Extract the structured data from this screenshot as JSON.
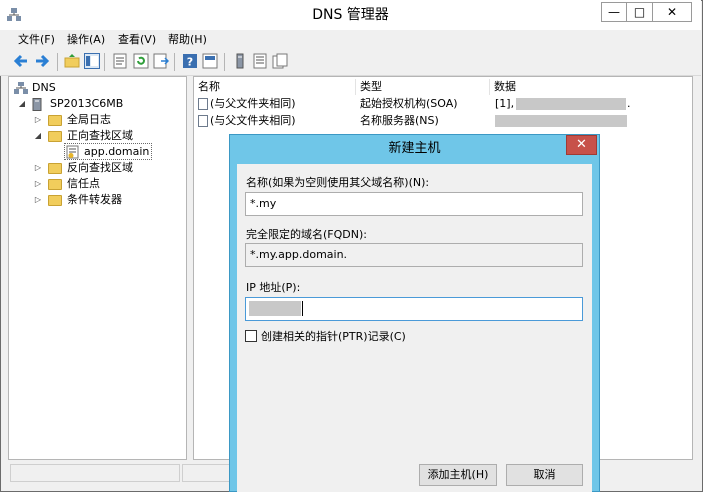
{
  "window": {
    "title": "DNS 管理器",
    "minimize": "—",
    "restore": "□",
    "close": "✕"
  },
  "menu": [
    "文件(F)",
    "操作(A)",
    "查看(V)",
    "帮助(H)"
  ],
  "toolbar_icons": [
    "back-arrow-icon",
    "forward-arrow-icon",
    "up-folder-icon",
    "show-tree-icon",
    "properties-icon",
    "refresh-icon",
    "export-list-icon",
    "help-icon",
    "console-icon",
    "server-icon",
    "zone-icon",
    "record-icon"
  ],
  "tree": {
    "root": "DNS",
    "server": "SP2013C6MB",
    "items": [
      {
        "label": "全局日志",
        "expanded": false
      },
      {
        "label": "正向查找区域",
        "expanded": true
      },
      {
        "label": "app.domain",
        "selected": true
      },
      {
        "label": "反向查找区域",
        "expanded": false
      },
      {
        "label": "信任点",
        "expanded": false
      },
      {
        "label": "条件转发器",
        "expanded": false
      }
    ]
  },
  "list": {
    "columns": [
      "名称",
      "类型",
      "数据"
    ],
    "rows": [
      {
        "name": "(与父文件夹相同)",
        "type": "起始授权机构(SOA)",
        "data": "[1],"
      },
      {
        "name": "(与父文件夹相同)",
        "type": "名称服务器(NS)",
        "data": ""
      }
    ]
  },
  "dialog": {
    "title": "新建主机",
    "close": "✕",
    "name_label": "名称(如果为空则使用其父域名称)(N):",
    "name_value": "*.my",
    "fqdn_label": "完全限定的域名(FQDN):",
    "fqdn_value": "*.my.app.domain.",
    "ip_label": "IP 地址(P):",
    "ip_value": "",
    "ptr_label": "创建相关的指针(PTR)记录(C)",
    "ptr_checked": false,
    "add_button": "添加主机(H)",
    "cancel_button": "取消"
  },
  "colors": {
    "dialog_frame": "#6fc6e8",
    "close_red": "#c7514a",
    "folder": "#f1cd5c"
  }
}
